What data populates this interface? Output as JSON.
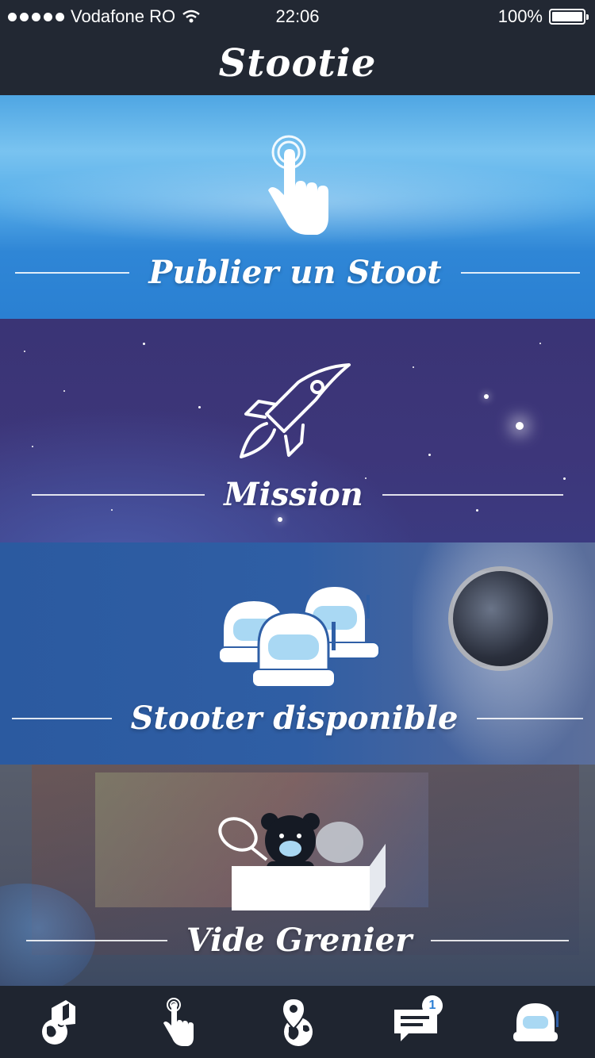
{
  "status_bar": {
    "carrier": "Vodafone RO",
    "time": "22:06",
    "battery": "100%"
  },
  "navbar": {
    "title": "Stootie"
  },
  "panels": [
    {
      "label": "Publier un Stoot",
      "icon": "tap-hand-icon"
    },
    {
      "label": "Mission",
      "icon": "rocket-icon"
    },
    {
      "label": "Stooter disponible",
      "icon": "astronaut-helmets-icon"
    },
    {
      "label": "Vide Grenier",
      "icon": "box-items-icon"
    }
  ],
  "tabbar": {
    "items": [
      {
        "name": "globe-house-icon"
      },
      {
        "name": "tap-hand-icon"
      },
      {
        "name": "globe-pin-icon"
      },
      {
        "name": "chat-icon",
        "badge": "1"
      },
      {
        "name": "helmet-icon"
      }
    ]
  },
  "colors": {
    "status_bg": "#222833",
    "panel_blue": "#2f86d6",
    "panel_purple": "#3a3475",
    "panel_navy": "#2b5aa0",
    "panel_gray": "#505667"
  }
}
